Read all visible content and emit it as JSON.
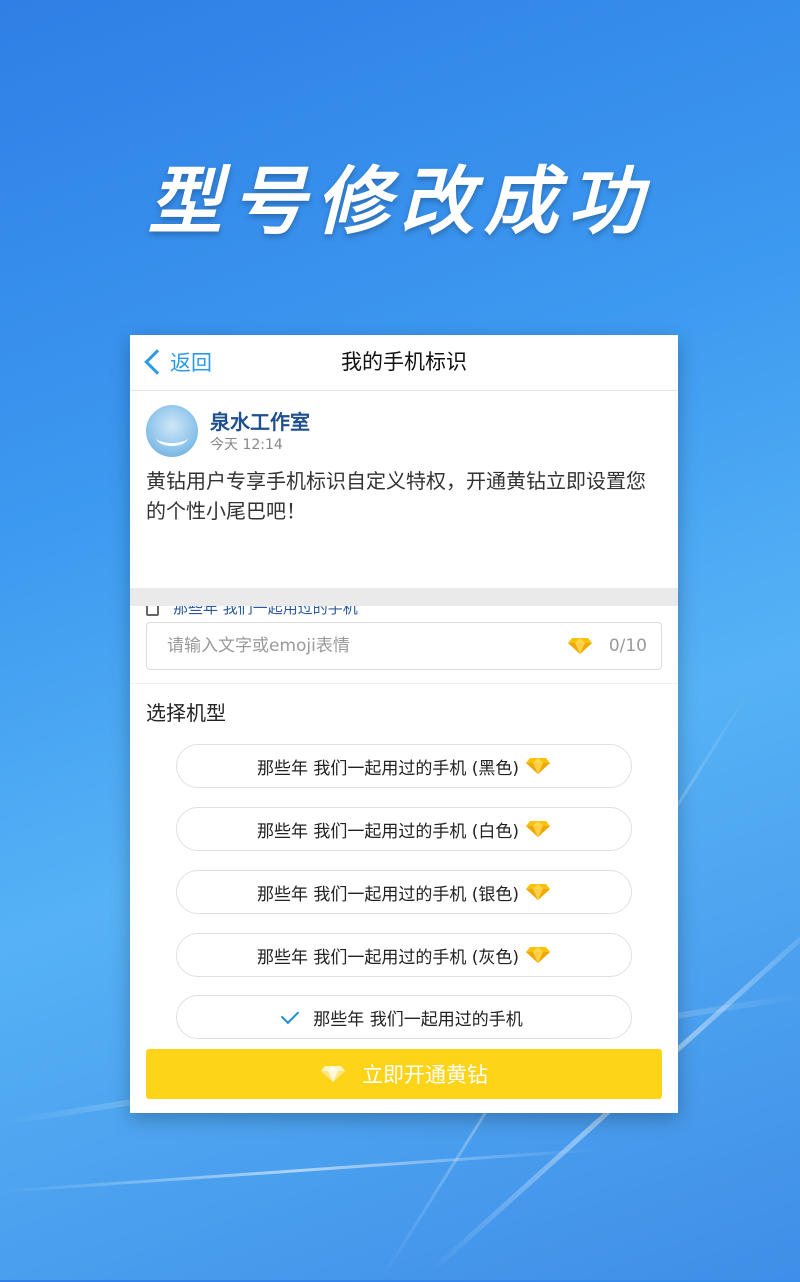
{
  "headline": "型号修改成功",
  "nav": {
    "back_label": "返回",
    "title": "我的手机标识"
  },
  "post": {
    "author": "泉水工作室",
    "time": "今天 12:14",
    "text": "黄钻用户专享手机标识自定义特权，开通黄钻立即设置您的个性小尾巴吧！",
    "tail": "那些年 我们一起用过的手机"
  },
  "input": {
    "placeholder": "请输入文字或emoji表情",
    "counter": "0/10"
  },
  "section_title": "选择机型",
  "options": [
    {
      "label": "那些年 我们一起用过的手机 (黑色)",
      "vip": true,
      "selected": false
    },
    {
      "label": "那些年 我们一起用过的手机 (白色)",
      "vip": true,
      "selected": false
    },
    {
      "label": "那些年 我们一起用过的手机 (银色)",
      "vip": true,
      "selected": false
    },
    {
      "label": "那些年 我们一起用过的手机 (灰色)",
      "vip": true,
      "selected": false
    },
    {
      "label": "那些年 我们一起用过的手机",
      "vip": false,
      "selected": true
    }
  ],
  "cta_label": "立即开通黄钻",
  "colors": {
    "accent": "#2c9be6",
    "cta": "#fed419",
    "diamond": "#f7c30a"
  }
}
